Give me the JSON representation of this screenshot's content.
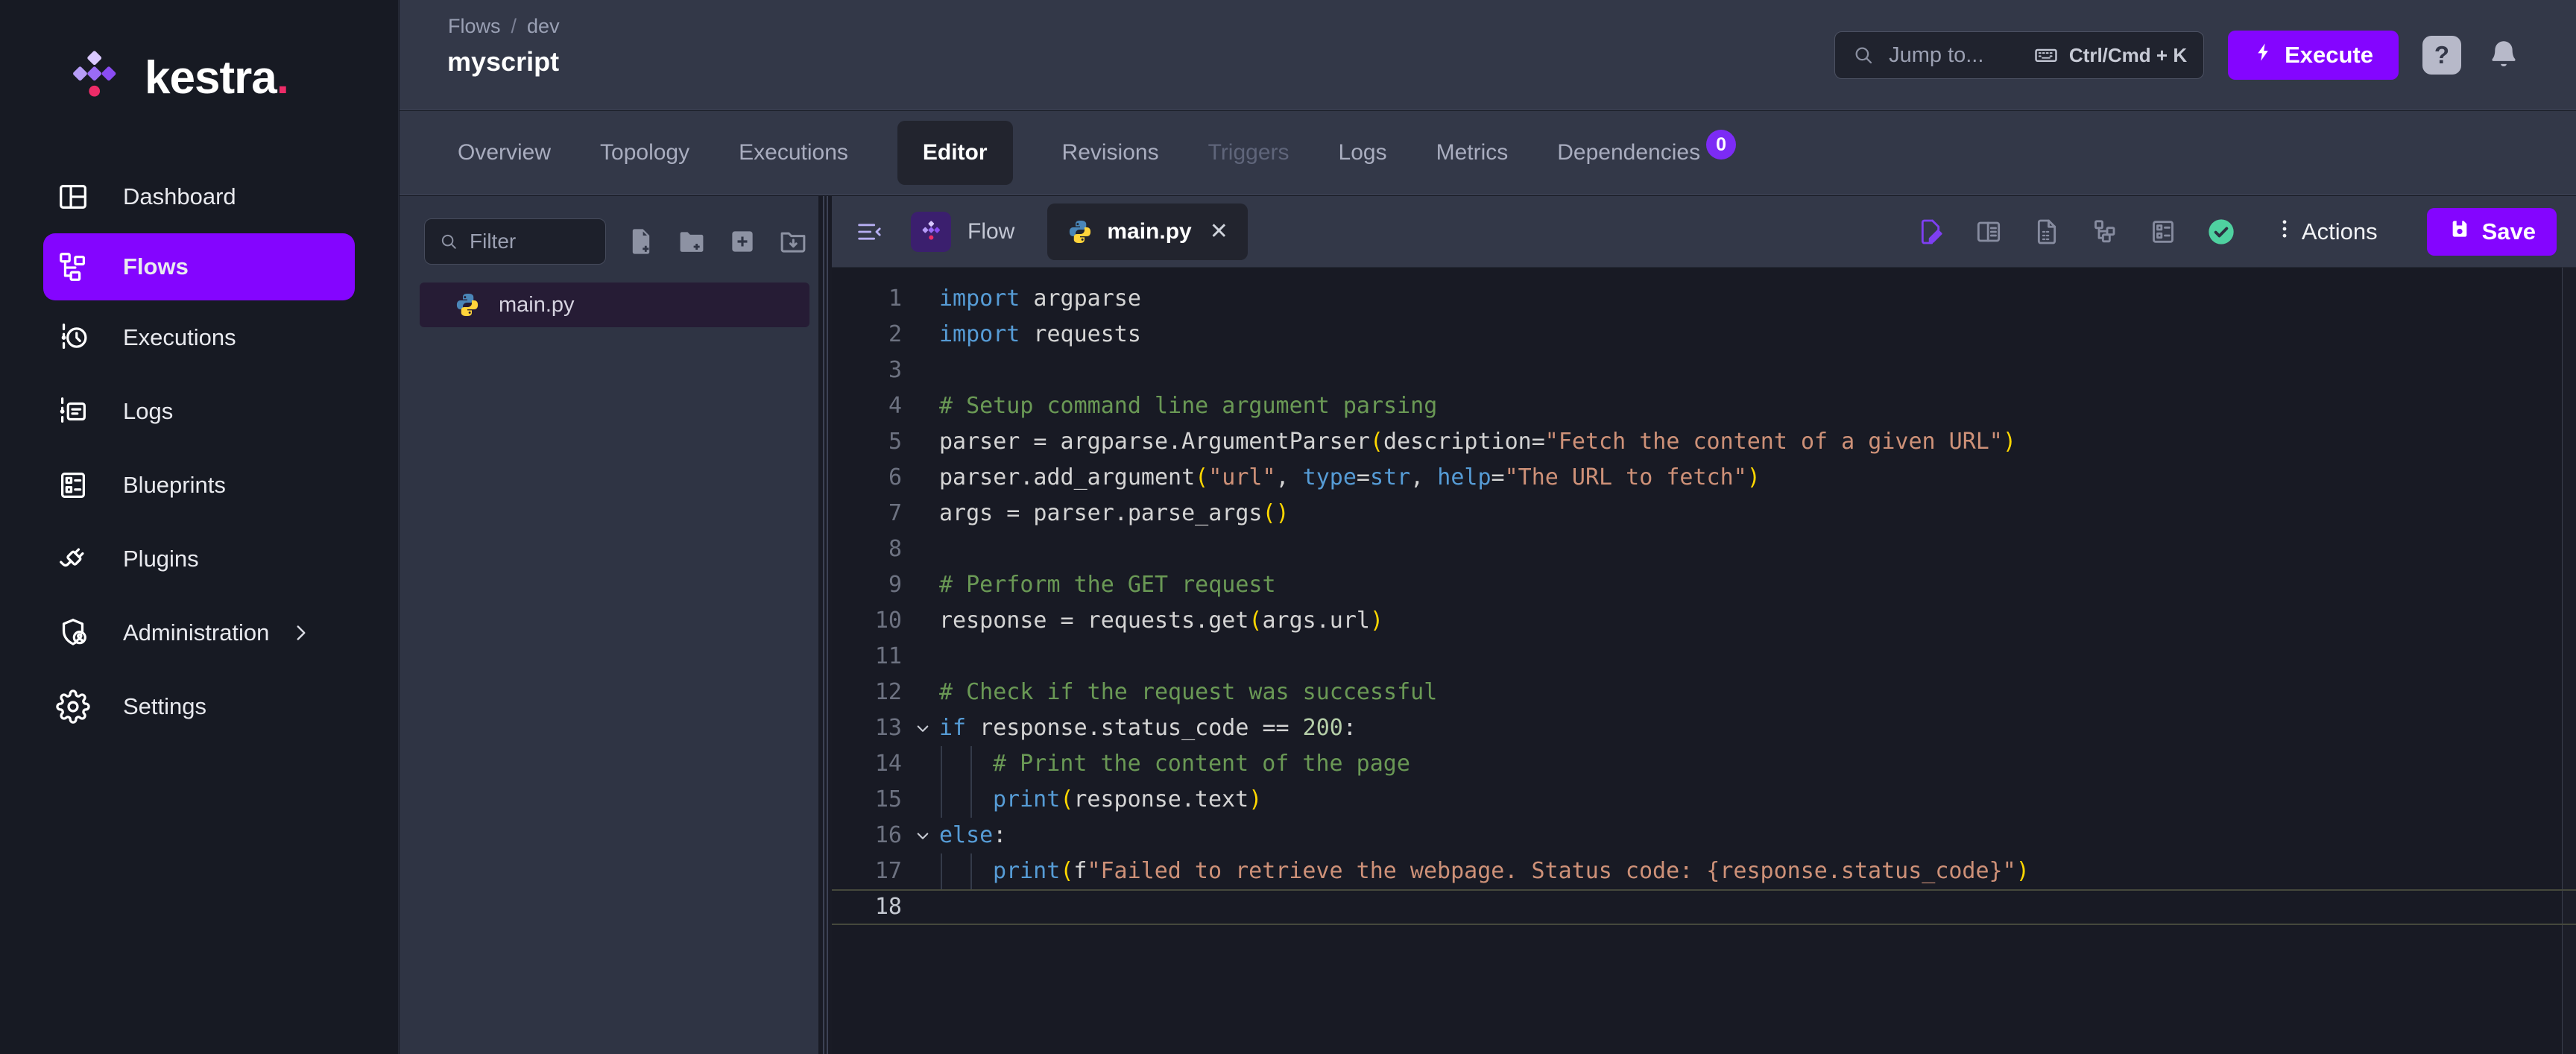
{
  "colors": {
    "accent": "#8405ff",
    "badge": "#7c2bf5",
    "valid_green": "#4fd1a0",
    "bars_bg": "#333848",
    "editor_bg": "#181a24",
    "sidebar_bg": "#171a23"
  },
  "sidebar": {
    "logo_text": "kestra",
    "logo_dot": ".",
    "items": [
      {
        "label": "Dashboard",
        "icon": "dashboard-icon",
        "active": false
      },
      {
        "label": "Flows",
        "icon": "flows-icon",
        "active": true
      },
      {
        "label": "Executions",
        "icon": "executions-icon",
        "active": false
      },
      {
        "label": "Logs",
        "icon": "logs-icon",
        "active": false
      },
      {
        "label": "Blueprints",
        "icon": "blueprints-icon",
        "active": false
      },
      {
        "label": "Plugins",
        "icon": "plugins-icon",
        "active": false
      },
      {
        "label": "Administration",
        "icon": "administration-icon",
        "active": false,
        "chevron": true
      },
      {
        "label": "Settings",
        "icon": "settings-icon",
        "active": false
      }
    ]
  },
  "topbar": {
    "breadcrumb": [
      "Flows",
      "dev"
    ],
    "breadcrumb_separator": "/",
    "title": "myscript",
    "search": {
      "placeholder": "Jump to...",
      "shortcut": "Ctrl/Cmd + K"
    },
    "execute_label": "Execute",
    "help_label": "?"
  },
  "flow_tabs": [
    {
      "label": "Overview"
    },
    {
      "label": "Topology"
    },
    {
      "label": "Executions"
    },
    {
      "label": "Editor",
      "active": true
    },
    {
      "label": "Revisions"
    },
    {
      "label": "Triggers",
      "disabled": true
    },
    {
      "label": "Logs"
    },
    {
      "label": "Metrics"
    },
    {
      "label": "Dependencies",
      "badge": "0"
    }
  ],
  "explorer": {
    "filter_placeholder": "Filter",
    "toolbar_icons": [
      "new-file-icon",
      "new-folder-icon",
      "add-icon",
      "import-folder-icon"
    ],
    "file": {
      "name": "main.py",
      "selected": true
    }
  },
  "editor": {
    "flow_tab_label": "Flow",
    "file_tab_label": "main.py",
    "close_glyph": "✕",
    "toolbar_icons": [
      "edit-doc-icon",
      "split-panel-icon",
      "file-lines-icon",
      "topology-icon",
      "blueprint-icon",
      "valid-check-icon"
    ],
    "actions_label": "Actions",
    "save_label": "Save",
    "lines": [
      {
        "n": "1",
        "tokens": [
          [
            "k",
            "import"
          ],
          [
            "i",
            " argparse"
          ]
        ]
      },
      {
        "n": "2",
        "tokens": [
          [
            "k",
            "import"
          ],
          [
            "i",
            " requests"
          ]
        ]
      },
      {
        "n": "3",
        "tokens": []
      },
      {
        "n": "4",
        "tokens": [
          [
            "c",
            "# Setup command line argument parsing"
          ]
        ]
      },
      {
        "n": "5",
        "tokens": [
          [
            "i",
            "parser = argparse.ArgumentParser"
          ],
          [
            "b",
            "("
          ],
          [
            "i",
            "description="
          ],
          [
            "s",
            "\"Fetch the content of a given URL\""
          ],
          [
            "b",
            ")"
          ]
        ]
      },
      {
        "n": "6",
        "tokens": [
          [
            "i",
            "parser.add_argument"
          ],
          [
            "b",
            "("
          ],
          [
            "s",
            "\"url\""
          ],
          [
            "i",
            ", "
          ],
          [
            "k",
            "type"
          ],
          [
            "i",
            "="
          ],
          [
            "k",
            "str"
          ],
          [
            "i",
            ", "
          ],
          [
            "k",
            "help"
          ],
          [
            "i",
            "="
          ],
          [
            "s",
            "\"The URL to fetch\""
          ],
          [
            "b",
            ")"
          ]
        ]
      },
      {
        "n": "7",
        "tokens": [
          [
            "i",
            "args = parser.parse_args"
          ],
          [
            "b",
            "()"
          ]
        ]
      },
      {
        "n": "8",
        "tokens": []
      },
      {
        "n": "9",
        "tokens": [
          [
            "c",
            "# Perform the GET request"
          ]
        ]
      },
      {
        "n": "10",
        "tokens": [
          [
            "i",
            "response = requests.get"
          ],
          [
            "b",
            "("
          ],
          [
            "i",
            "args.url"
          ],
          [
            "b",
            ")"
          ]
        ]
      },
      {
        "n": "11",
        "tokens": []
      },
      {
        "n": "12",
        "tokens": [
          [
            "c",
            "# Check if the request was successful"
          ]
        ]
      },
      {
        "n": "13",
        "fold": true,
        "tokens": [
          [
            "k",
            "if"
          ],
          [
            "i",
            " response.status_code == "
          ],
          [
            "n",
            "200"
          ],
          [
            "i",
            ":"
          ]
        ]
      },
      {
        "n": "14",
        "indent": 1,
        "tokens": [
          [
            "c",
            "# Print the content of the page"
          ]
        ]
      },
      {
        "n": "15",
        "indent": 1,
        "tokens": [
          [
            "k",
            "print"
          ],
          [
            "b",
            "("
          ],
          [
            "i",
            "response.text"
          ],
          [
            "b",
            ")"
          ]
        ]
      },
      {
        "n": "16",
        "fold": true,
        "tokens": [
          [
            "k",
            "else"
          ],
          [
            "i",
            ":"
          ]
        ]
      },
      {
        "n": "17",
        "indent": 1,
        "tokens": [
          [
            "k",
            "print"
          ],
          [
            "b",
            "("
          ],
          [
            "i",
            "f"
          ],
          [
            "s",
            "\"Failed to retrieve the webpage. Status code: {response.status_code}\""
          ],
          [
            "b",
            ")"
          ]
        ]
      },
      {
        "n": "18",
        "current": true,
        "tokens": []
      }
    ]
  }
}
